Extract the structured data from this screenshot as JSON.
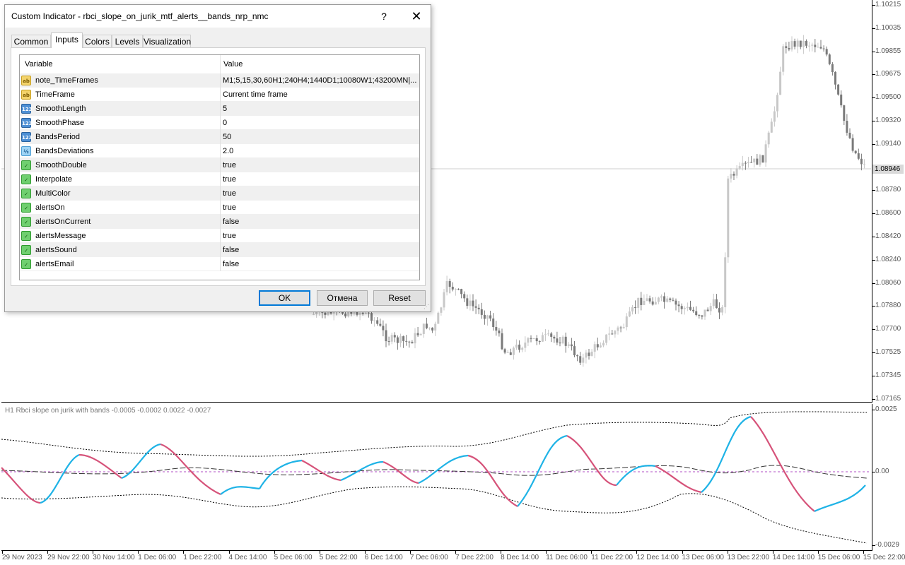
{
  "dialog": {
    "title": "Custom Indicator - rbci_slope_on_jurik_mtf_alerts__bands_nrp_nmc",
    "help_label": "?",
    "close_label": "✕",
    "tabs": [
      {
        "label": "Common"
      },
      {
        "label": "Inputs"
      },
      {
        "label": "Colors"
      },
      {
        "label": "Levels"
      },
      {
        "label": "Visualization"
      }
    ],
    "active_tab": "Inputs",
    "columns": {
      "variable": "Variable",
      "value": "Value"
    },
    "rows": [
      {
        "icon": "string-icon",
        "type": "string",
        "name": "note_TimeFrames",
        "value": "M1;5,15,30,60H1;240H4;1440D1;10080W1;43200MN|..."
      },
      {
        "icon": "string-icon",
        "type": "string",
        "name": "TimeFrame",
        "value": "Current time frame"
      },
      {
        "icon": "integer-icon",
        "type": "int",
        "name": "SmoothLength",
        "value": "5"
      },
      {
        "icon": "integer-icon",
        "type": "int",
        "name": "SmoothPhase",
        "value": "0"
      },
      {
        "icon": "integer-icon",
        "type": "int",
        "name": "BandsPeriod",
        "value": "50"
      },
      {
        "icon": "double-icon",
        "type": "double",
        "name": "BandsDeviations",
        "value": "2.0"
      },
      {
        "icon": "boolean-icon",
        "type": "bool",
        "name": "SmoothDouble",
        "value": "true"
      },
      {
        "icon": "boolean-icon",
        "type": "bool",
        "name": "Interpolate",
        "value": "true"
      },
      {
        "icon": "boolean-icon",
        "type": "bool",
        "name": "MultiColor",
        "value": "true"
      },
      {
        "icon": "boolean-icon",
        "type": "bool",
        "name": "alertsOn",
        "value": "true"
      },
      {
        "icon": "boolean-icon",
        "type": "bool",
        "name": "alertsOnCurrent",
        "value": "false"
      },
      {
        "icon": "boolean-icon",
        "type": "bool",
        "name": "alertsMessage",
        "value": "true"
      },
      {
        "icon": "boolean-icon",
        "type": "bool",
        "name": "alertsSound",
        "value": "false"
      },
      {
        "icon": "boolean-icon",
        "type": "bool",
        "name": "alertsEmail",
        "value": "false"
      }
    ],
    "buttons": {
      "ok": "OK",
      "cancel": "Отмена",
      "reset": "Reset"
    }
  },
  "price_scale": {
    "labels": [
      "1.10215",
      "1.10035",
      "1.09855",
      "1.09675",
      "1.09500",
      "1.09320",
      "1.09140",
      "1.08780",
      "1.08600",
      "1.08420",
      "1.08240",
      "1.08060",
      "1.07880",
      "1.07700",
      "1.07525",
      "1.07345",
      "1.07165"
    ],
    "current_price": "1.08946"
  },
  "subwindow": {
    "label": "H1  Rbci slope on jurik with bands  -0.0005 -0.0002 0.0022 -0.0027",
    "scale_labels": [
      "0.0025",
      "0.00",
      "-0.0029"
    ]
  },
  "time_axis": {
    "labels": [
      "29 Nov 2023",
      "29 Nov 22:00",
      "30 Nov 14:00",
      "1 Dec 06:00",
      "1 Dec 22:00",
      "4 Dec 14:00",
      "5 Dec 06:00",
      "5 Dec 22:00",
      "6 Dec 14:00",
      "7 Dec 06:00",
      "7 Dec 22:00",
      "8 Dec 14:00",
      "11 Dec 06:00",
      "11 Dec 22:00",
      "12 Dec 14:00",
      "13 Dec 06:00",
      "13 Dec 22:00",
      "14 Dec 14:00",
      "15 Dec 06:00",
      "15 Dec 22:00"
    ]
  },
  "colors": {
    "slope_up": "#1fb3e6",
    "slope_down": "#d6537a",
    "candle_bull": "#c8c8c8",
    "candle_bear": "#7a7a7a",
    "zero_level": "#b04fc4",
    "band_line": "#000000"
  }
}
